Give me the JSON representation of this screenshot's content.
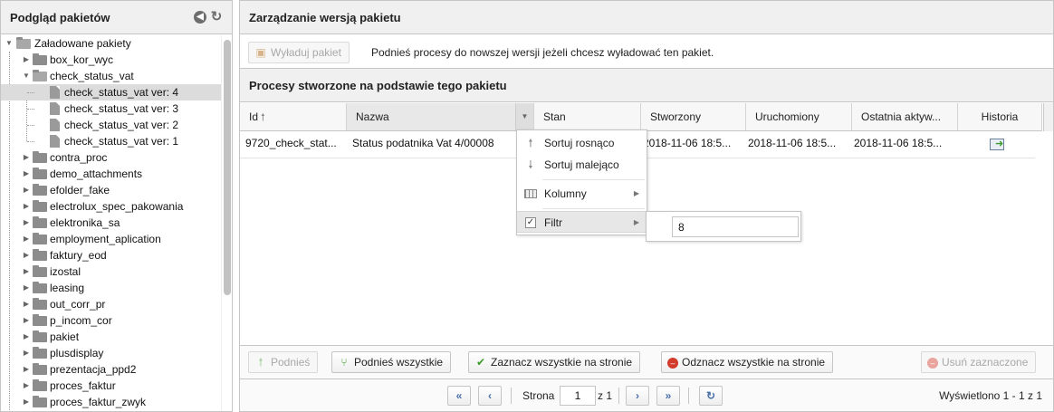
{
  "left_panel": {
    "title": "Podgląd pakietów",
    "tree": {
      "root": "Załadowane pakiety",
      "items": [
        {
          "label": "box_kor_wyc"
        },
        {
          "label": "check_status_vat",
          "children": [
            {
              "label": "check_status_vat ver: 4",
              "selected": true
            },
            {
              "label": "check_status_vat ver: 3"
            },
            {
              "label": "check_status_vat ver: 2"
            },
            {
              "label": "check_status_vat ver: 1"
            }
          ]
        },
        {
          "label": "contra_proc"
        },
        {
          "label": "demo_attachments"
        },
        {
          "label": "efolder_fake"
        },
        {
          "label": "electrolux_spec_pakowania"
        },
        {
          "label": "elektronika_sa"
        },
        {
          "label": "employment_aplication"
        },
        {
          "label": "faktury_eod"
        },
        {
          "label": "izostal"
        },
        {
          "label": "leasing"
        },
        {
          "label": "out_corr_pr"
        },
        {
          "label": "p_incom_cor"
        },
        {
          "label": "pakiet"
        },
        {
          "label": "plusdisplay"
        },
        {
          "label": "prezentacja_ppd2"
        },
        {
          "label": "proces_faktur"
        },
        {
          "label": "proces_faktur_zwyk"
        }
      ]
    }
  },
  "right_panel": {
    "title": "Zarządzanie wersją pakietu",
    "unload_button": "Wyładuj pakiet",
    "description": "Podnieś procesy do nowszej wersji jeżeli chcesz wyładować ten pakiet.",
    "subsection_title": "Procesy stworzone na podstawie tego pakietu",
    "grid": {
      "columns": [
        "Id",
        "Nazwa",
        "Stan",
        "Stworzony",
        "Uruchomiony",
        "Ostatnia aktyw...",
        "Historia"
      ],
      "sorted_column": "Id",
      "rows": [
        {
          "id": "9720_check_stat...",
          "name": "Status podatnika Vat 4/00008",
          "state": "",
          "created": "2018-11-06 18:5...",
          "started": "2018-11-06 18:5...",
          "last_activity": "2018-11-06 18:5...",
          "history_icon": "history-icon"
        }
      ]
    },
    "column_menu": {
      "sort_asc": "Sortuj rosnąco",
      "sort_desc": "Sortuj malejąco",
      "columns": "Kolumny",
      "filter": "Filtr",
      "filter_checked": true,
      "filter_value": "8"
    },
    "actions": {
      "promote": "Podnieś",
      "promote_all": "Podnieś wszystkie",
      "select_all": "Zaznacz wszystkie na stronie",
      "deselect_all": "Odznacz wszystkie na stronie",
      "delete_selected": "Usuń zaznaczone"
    },
    "pager": {
      "page_label": "Strona",
      "page_value": "1",
      "of_label": "z 1",
      "info": "Wyświetlono 1 - 1 z 1"
    }
  },
  "colors": {
    "header_bg": "#f0f0f0",
    "border": "#c5c5c5",
    "selected_row": "#dcdcdc",
    "pager_icon": "#4a70a8",
    "green_icon": "#3a9a2a",
    "red_icon": "#d23a2c"
  }
}
